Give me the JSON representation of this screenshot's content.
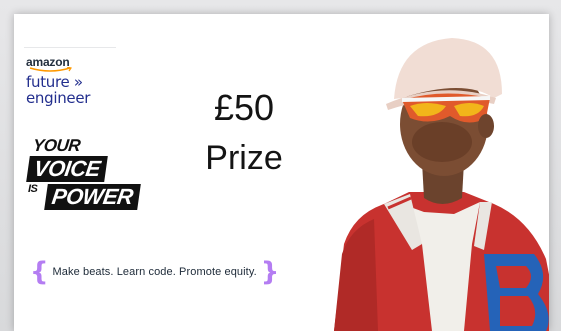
{
  "logo": {
    "amazon": "amazon",
    "future_engineer": "future »",
    "engineer": "engineer"
  },
  "campaign": {
    "line1": "YOUR",
    "line2": "VOICE",
    "line3a": "IS",
    "line3b": "POWER"
  },
  "prize": {
    "amount": "£50",
    "label": "Prize"
  },
  "tagline": {
    "open": "{",
    "text": "Make beats. Learn code. Promote equity.",
    "close": "}"
  },
  "colors": {
    "brace": "#b47df2",
    "logo_blue": "#232f8e",
    "jacket_red": "#c8322f"
  }
}
